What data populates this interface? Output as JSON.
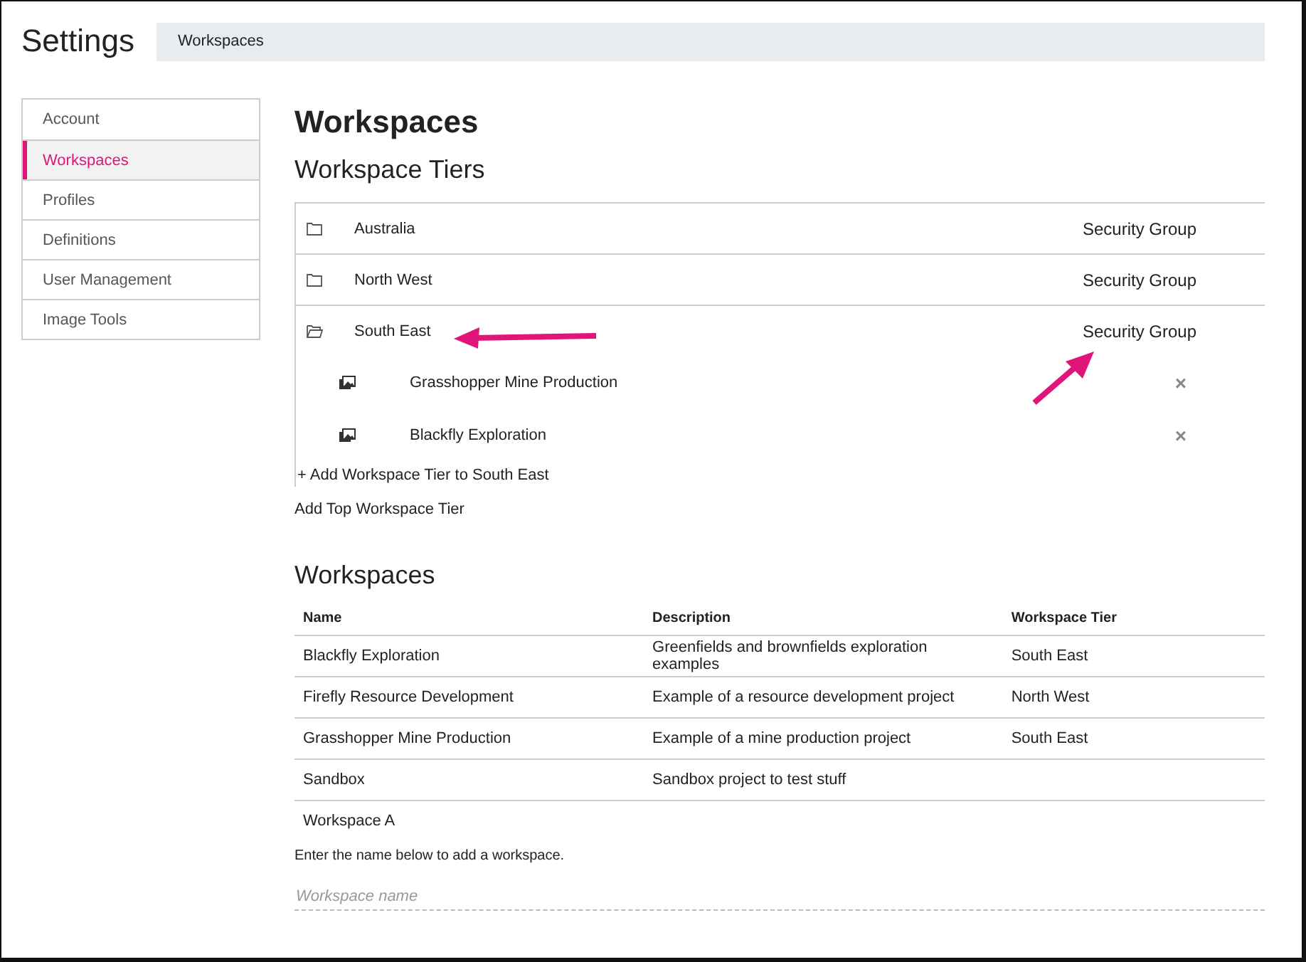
{
  "header": {
    "title": "Settings",
    "breadcrumb": "Workspaces"
  },
  "sidebar": {
    "items": [
      {
        "label": "Account",
        "selected": false
      },
      {
        "label": "Workspaces",
        "selected": true
      },
      {
        "label": "Profiles",
        "selected": false
      },
      {
        "label": "Definitions",
        "selected": false
      },
      {
        "label": "User Management",
        "selected": false
      },
      {
        "label": "Image Tools",
        "selected": false
      }
    ]
  },
  "page_title": "Workspaces",
  "tiers": {
    "heading": "Workspace Tiers",
    "items": [
      {
        "label": "Australia",
        "expanded": false,
        "security_group": "Security Group"
      },
      {
        "label": "North West",
        "expanded": false,
        "security_group": "Security Group"
      },
      {
        "label": "South East",
        "expanded": true,
        "security_group": "Security Group",
        "children": [
          {
            "label": "Grasshopper Mine Production",
            "remove": "×"
          },
          {
            "label": "Blackfly Exploration",
            "remove": "×"
          }
        ],
        "add_link": "+ Add Workspace Tier to South East"
      }
    ],
    "add_top": "Add Top Workspace Tier"
  },
  "workspaces": {
    "heading": "Workspaces",
    "columns": [
      "Name",
      "Description",
      "Workspace Tier"
    ],
    "rows": [
      [
        "Blackfly Exploration",
        "Greenfields and brownfields exploration examples",
        "South East"
      ],
      [
        "Firefly Resource Development",
        "Example of a resource development project",
        "North West"
      ],
      [
        "Grasshopper Mine Production",
        "Example of a mine production project",
        "South East"
      ],
      [
        "Sandbox",
        "Sandbox project to test stuff",
        ""
      ],
      [
        "Workspace A",
        "",
        ""
      ]
    ],
    "note": "Enter the name below to add a workspace.",
    "input": {
      "placeholder": "Workspace name"
    }
  }
}
